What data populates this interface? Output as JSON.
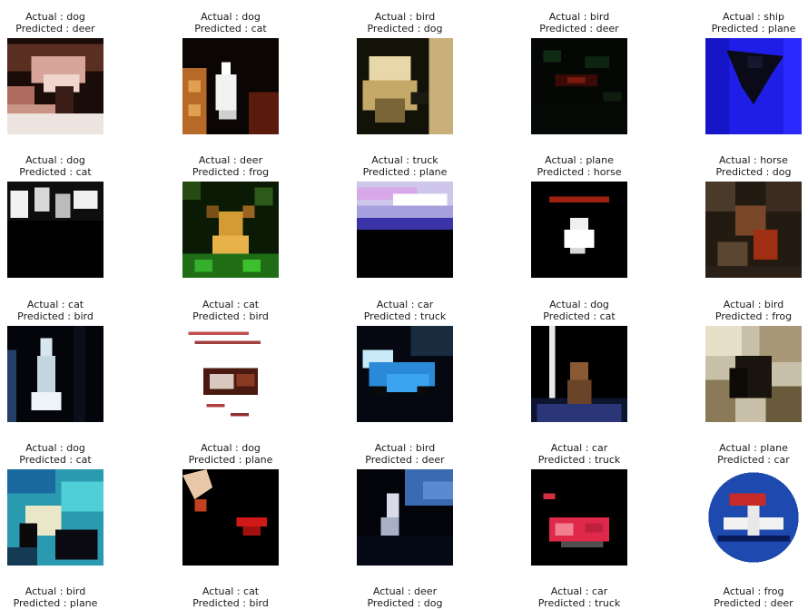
{
  "figure": {
    "columns": 5,
    "actual_prefix": "Actual : ",
    "predicted_prefix": "Predicted : ",
    "samples": [
      {
        "actual": "dog",
        "predicted": "deer",
        "scene": "dog-deer"
      },
      {
        "actual": "dog",
        "predicted": "cat",
        "scene": "dog-cat-a"
      },
      {
        "actual": "bird",
        "predicted": "dog",
        "scene": "bird-dog"
      },
      {
        "actual": "bird",
        "predicted": "deer",
        "scene": "bird-deer"
      },
      {
        "actual": "ship",
        "predicted": "plane",
        "scene": "ship-plane"
      },
      {
        "actual": "dog",
        "predicted": "cat",
        "scene": "dog-cat-b"
      },
      {
        "actual": "deer",
        "predicted": "frog",
        "scene": "deer-frog"
      },
      {
        "actual": "truck",
        "predicted": "plane",
        "scene": "truck-plane"
      },
      {
        "actual": "plane",
        "predicted": "horse",
        "scene": "plane-horse"
      },
      {
        "actual": "horse",
        "predicted": "dog",
        "scene": "horse-dog"
      },
      {
        "actual": "cat",
        "predicted": "bird",
        "scene": "cat-bird-a"
      },
      {
        "actual": "cat",
        "predicted": "bird",
        "scene": "cat-bird-b"
      },
      {
        "actual": "car",
        "predicted": "truck",
        "scene": "car-truck-a"
      },
      {
        "actual": "dog",
        "predicted": "cat",
        "scene": "dog-cat-c"
      },
      {
        "actual": "bird",
        "predicted": "frog",
        "scene": "bird-frog"
      },
      {
        "actual": "dog",
        "predicted": "cat",
        "scene": "dog-cat-d"
      },
      {
        "actual": "dog",
        "predicted": "plane",
        "scene": "dog-plane"
      },
      {
        "actual": "bird",
        "predicted": "deer",
        "scene": "bird-deer-b"
      },
      {
        "actual": "car",
        "predicted": "truck",
        "scene": "car-truck-b"
      },
      {
        "actual": "plane",
        "predicted": "car",
        "scene": "plane-car"
      },
      {
        "actual": "bird",
        "predicted": "plane",
        "scene": "none"
      },
      {
        "actual": "cat",
        "predicted": "bird",
        "scene": "none"
      },
      {
        "actual": "deer",
        "predicted": "dog",
        "scene": "none"
      },
      {
        "actual": "car",
        "predicted": "truck",
        "scene": "none"
      },
      {
        "actual": "frog",
        "predicted": "deer",
        "scene": "none"
      }
    ]
  }
}
